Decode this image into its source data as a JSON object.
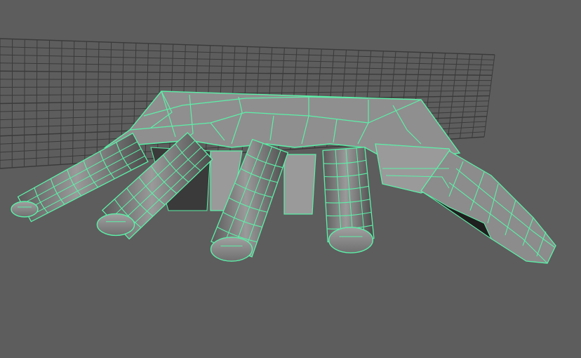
{
  "viewport": {
    "background_color": "#5d5d5d",
    "grid_color": "#3a3a3a",
    "wireframe_color": "#5cf0a8",
    "mesh_fill_color": "#8c8c8c",
    "mesh_shadow_color": "#2e2e2e"
  },
  "mesh": {
    "object": "hand",
    "selected": true,
    "display_mode": "shaded-wireframe",
    "fingers": [
      {
        "name": "pinky"
      },
      {
        "name": "ring"
      },
      {
        "name": "middle"
      },
      {
        "name": "index"
      },
      {
        "name": "thumb"
      }
    ]
  }
}
